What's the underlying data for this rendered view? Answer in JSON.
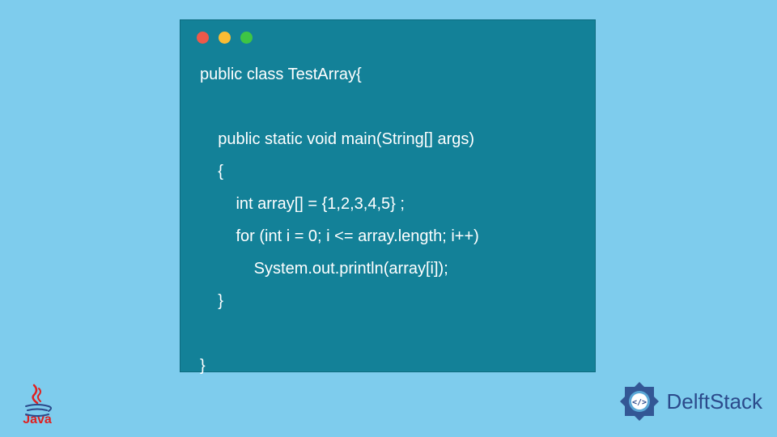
{
  "code": {
    "lines": [
      "public class TestArray{",
      "",
      "    public static void main(String[] args)",
      "    {",
      "        int array[] = {1,2,3,4,5} ;",
      "        for (int i = 0; i <= array.length; i++)",
      "            System.out.println(array[i]);",
      "    }",
      "",
      "}"
    ]
  },
  "logos": {
    "java_label": "Java",
    "delft_label": "DelftStack"
  },
  "colors": {
    "background": "#7ecced",
    "window_bg": "#138198",
    "code_text": "#ffffff",
    "java_red": "#e02020",
    "delft_blue": "#2b4a8b"
  }
}
